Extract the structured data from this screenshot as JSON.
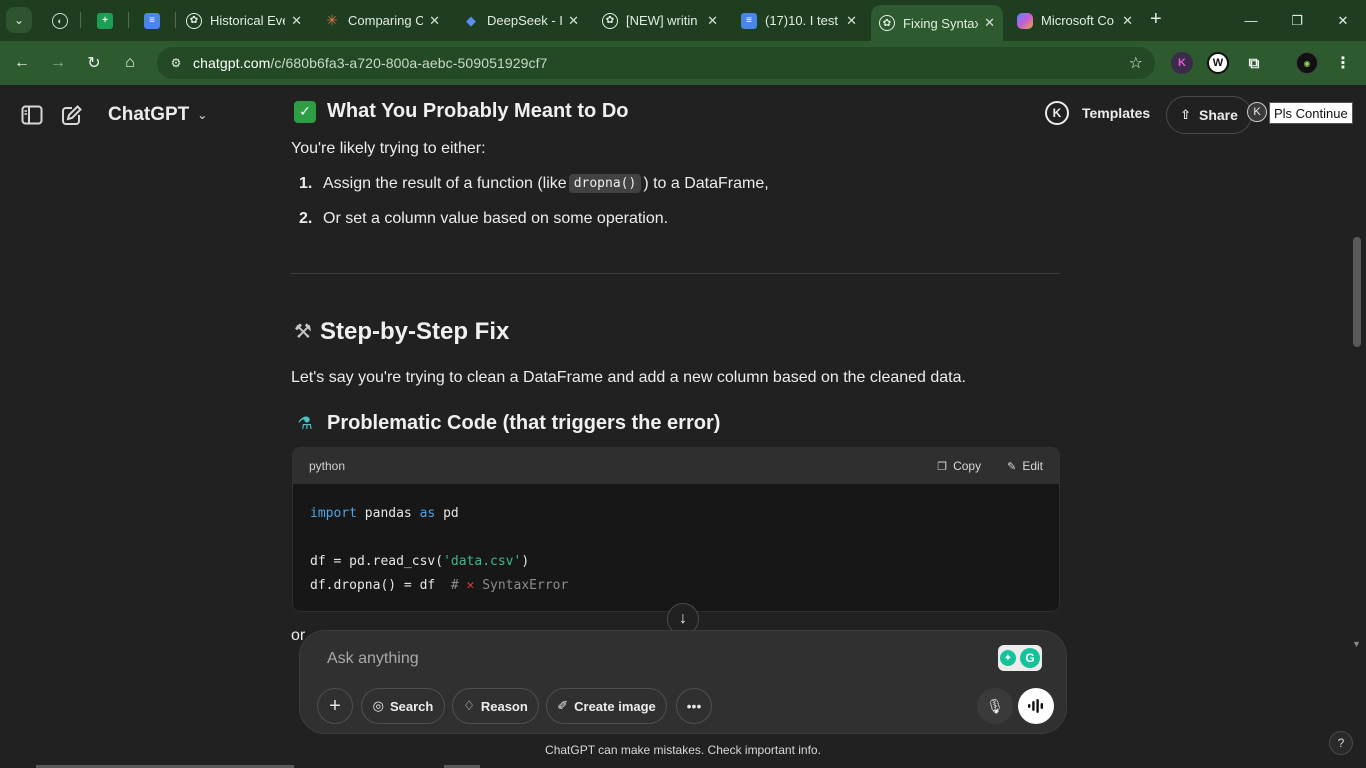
{
  "browser": {
    "tabs": [
      {
        "title": "",
        "icon": "globe-icon"
      },
      {
        "title": "",
        "icon": "sheets-icon"
      },
      {
        "title": "",
        "icon": "docs-icon"
      },
      {
        "title": "Historical Eve",
        "icon": "chatgpt-icon"
      },
      {
        "title": "Comparing C",
        "icon": "claude-icon"
      },
      {
        "title": "DeepSeek - I",
        "icon": "deepseek-icon"
      },
      {
        "title": "[NEW] writin",
        "icon": "chatgpt-icon"
      },
      {
        "title": "(17)10. I test",
        "icon": "docs-icon"
      },
      {
        "title": "Fixing Syntax",
        "icon": "chatgpt-icon",
        "active": true
      },
      {
        "title": "Microsoft Co",
        "icon": "copilot-icon"
      }
    ],
    "url_host": "chatgpt.com",
    "url_path": "/c/680b6fa3-a720-800a-aebc-509051929cf7"
  },
  "app": {
    "brand": "ChatGPT",
    "templates_label": "Templates",
    "share_label": "Share",
    "tooltip": "Pls Continue"
  },
  "message": {
    "heading1": "What You Probably Meant to Do",
    "intro": "You're likely trying to either:",
    "list": [
      {
        "num": "1.",
        "before": "Assign the result of a function (like ",
        "code": "dropna()",
        "after": ") to a DataFrame,"
      },
      {
        "num": "2.",
        "before": "Or set a column value based on some operation.",
        "code": "",
        "after": ""
      }
    ],
    "heading2": "Step-by-Step Fix",
    "para2": "Let's say you're trying to clean a DataFrame and add a new column based on the cleaned data.",
    "heading3": "Problematic Code (that triggers the error)",
    "code": {
      "lang": "python",
      "copy_label": "Copy",
      "edit_label": "Edit",
      "lines": [
        {
          "kw1": "import",
          "mid": " pandas ",
          "kw2": "as",
          "rest": " pd"
        },
        {
          "plain": "df = pd.read_csv(",
          "str": "'data.csv'",
          "close": ")"
        },
        {
          "plain": "df.dropna() = df  ",
          "comment": "# ",
          "x": "✕",
          "comment2": " SyntaxError"
        }
      ]
    },
    "trailing": "or"
  },
  "composer": {
    "placeholder": "Ask anything",
    "search_label": "Search",
    "reason_label": "Reason",
    "create_image_label": "Create image"
  },
  "footer": {
    "disclaimer": "ChatGPT can make mistakes. Check important info.",
    "help": "?"
  },
  "colors": {
    "browser_frame": "#1f3d20",
    "toolbar": "#2d5a2f",
    "page_bg": "#212121",
    "keyword": "#4fa3e6",
    "string": "#3fb886",
    "error_x": "#e53935"
  }
}
